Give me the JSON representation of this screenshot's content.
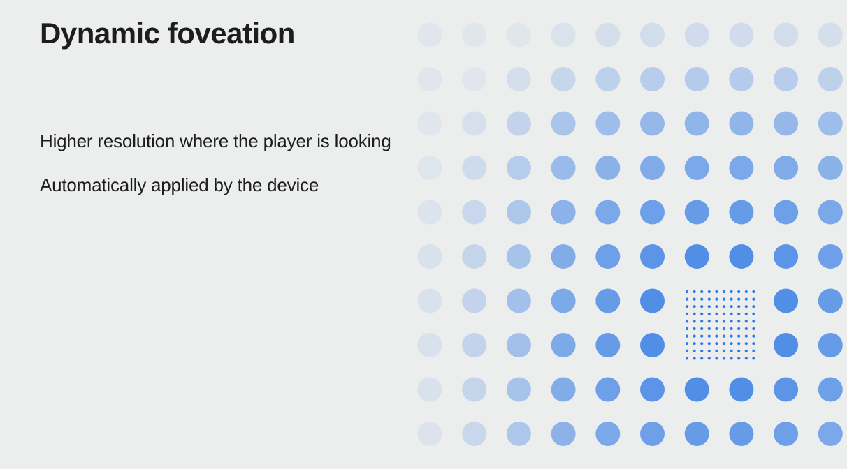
{
  "slide": {
    "title": "Dynamic foveation",
    "bullets": [
      "Higher resolution where the player is looking",
      "Automatically applied by the device"
    ]
  },
  "diagram": {
    "dot_color": "#2f7ae5",
    "background_color": "#eceded",
    "grid_columns": 10,
    "grid_rows": 10,
    "focus_region": "fine dense dot patch at center-right replacing four coarse dots",
    "falloff": "dots fade and lighten with distance from focus region"
  }
}
